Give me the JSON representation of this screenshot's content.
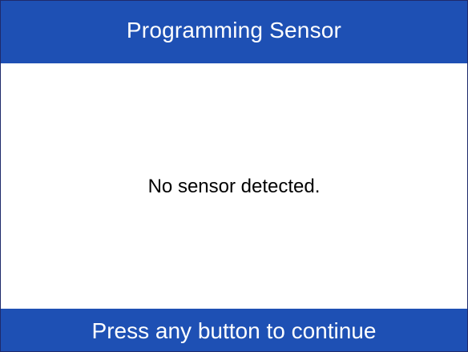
{
  "header": {
    "title": "Programming Sensor"
  },
  "main": {
    "message": "No sensor detected."
  },
  "footer": {
    "prompt": "Press any button to continue"
  },
  "colors": {
    "bar": "#1e50b4",
    "bar_text": "#ffffff",
    "body_background": "#ffffff",
    "body_text": "#000000"
  }
}
